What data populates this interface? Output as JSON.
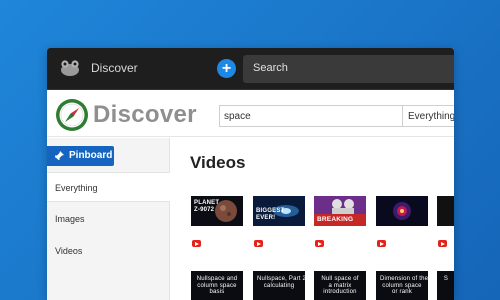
{
  "topbar": {
    "title": "Discover",
    "search_placeholder": "Search",
    "add_icon": "plus-icon",
    "logo_icon": "frog-logo-icon"
  },
  "brand": {
    "name": "Discover",
    "logo_icon": "compass-icon"
  },
  "query": {
    "value": "space",
    "scope": "Everything"
  },
  "sidebar": {
    "pinboard_label": "Pinboard",
    "items": [
      {
        "label": "Everything",
        "active": true
      },
      {
        "label": "Images",
        "active": false
      },
      {
        "label": "Videos",
        "active": false
      }
    ]
  },
  "main": {
    "heading": "Videos",
    "videos_row1": [
      {
        "label": "PLANET\nZ-9072",
        "source_icon": "youtube-icon"
      },
      {
        "label": "BIGGEST\nEVER!",
        "source_icon": "youtube-icon"
      },
      {
        "label": "BREAKING",
        "source_icon": "youtube-icon"
      },
      {
        "label": "",
        "source_icon": "youtube-icon"
      },
      {
        "label": "",
        "source_icon": "youtube-icon"
      }
    ],
    "videos_row2": [
      {
        "label": "Nullspace and\ncolumn space\nbasis"
      },
      {
        "label": "Nullspace, Part 2,\ncalculating"
      },
      {
        "label": "Null space of\na matrix\nintroduction"
      },
      {
        "label": "Dimension of the\ncolumn space\nor rank"
      },
      {
        "label": "S"
      }
    ]
  },
  "colors": {
    "background": "#1a74c7",
    "topbar": "#1e1e1e",
    "accent": "#1565c0",
    "youtube": "#e62117"
  }
}
